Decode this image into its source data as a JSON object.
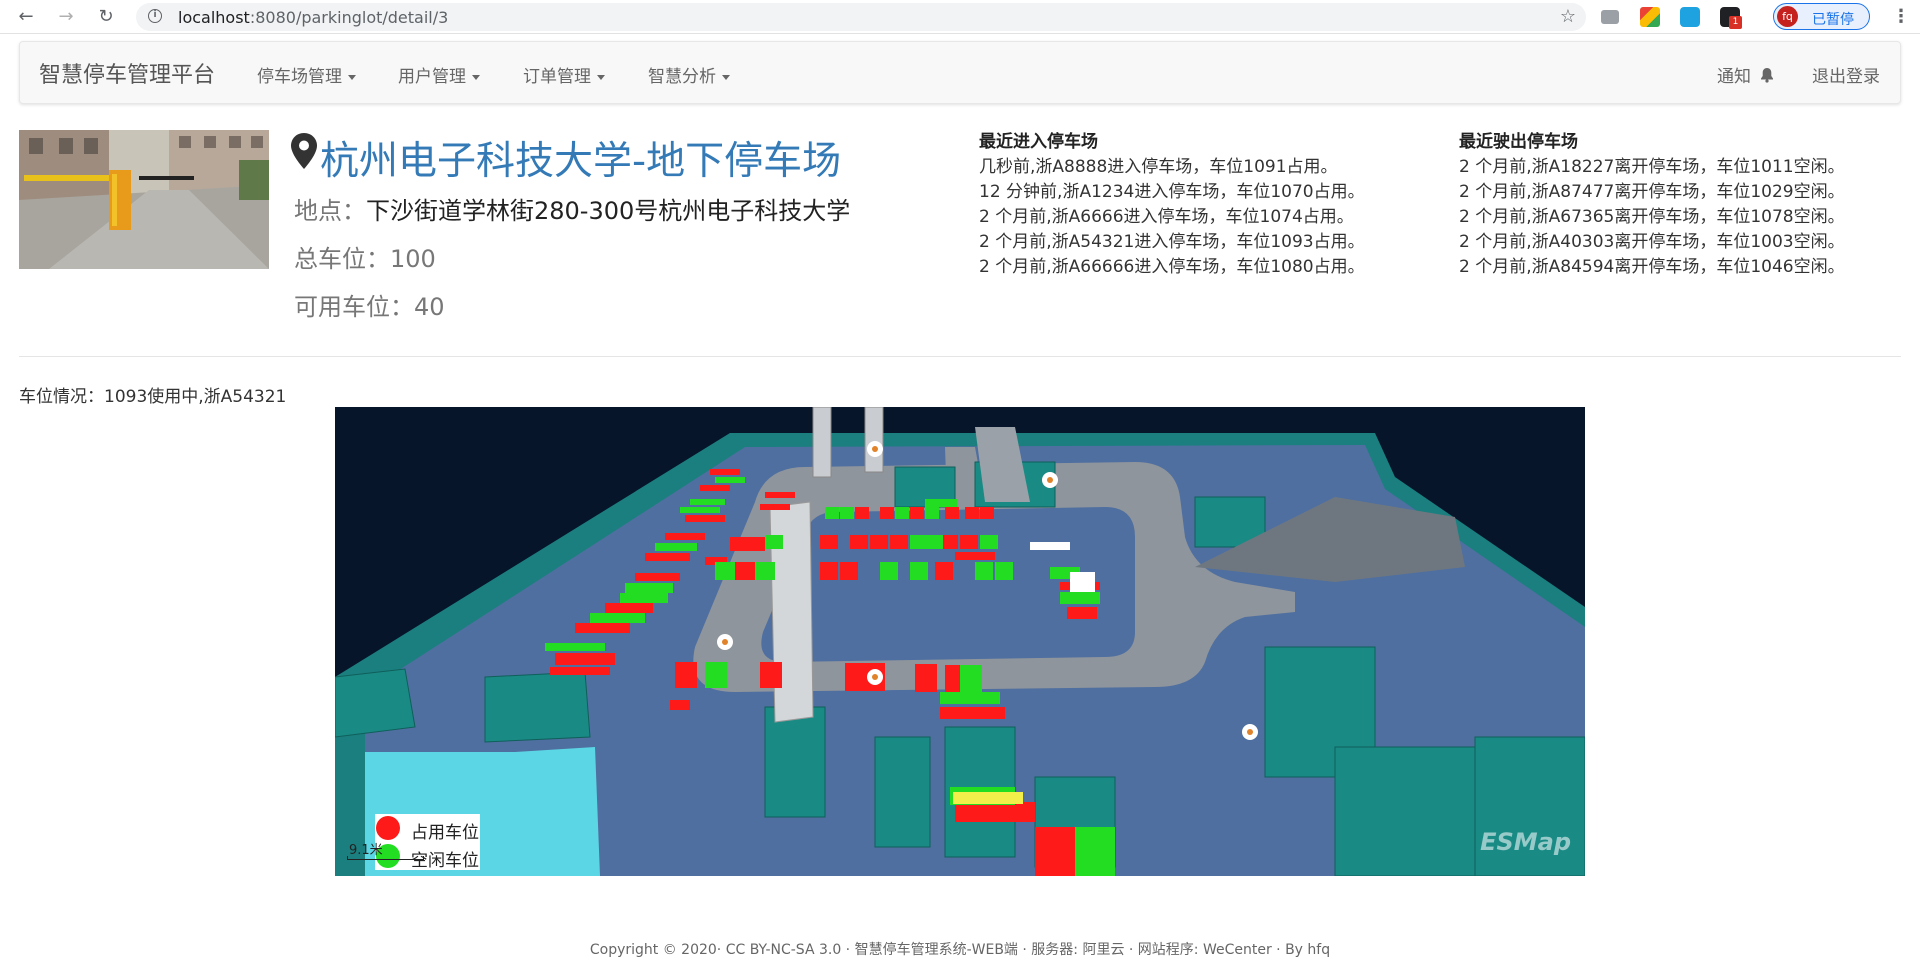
{
  "browser": {
    "url_host": "localhost",
    "url_path": ":8080/parkinglot/detail/3",
    "profile_initials": "fq",
    "profile_status": "已暂停",
    "ext_badge": "1"
  },
  "navbar": {
    "brand": "智慧停车管理平台",
    "menus": [
      "停车场管理",
      "用户管理",
      "订单管理",
      "智慧分析"
    ],
    "notify": "通知",
    "logout": "退出登录"
  },
  "lot": {
    "name": "杭州电子科技大学-地下停车场",
    "address_label": "地点：",
    "address": "下沙街道学林街280-300号杭州电子科技大学",
    "total_label": "总车位：",
    "total": "100",
    "available_label": "可用车位：",
    "available": "40"
  },
  "recent_in": {
    "title": "最近进入停车场",
    "entries": [
      "几秒前,浙A8888进入停车场，车位1091占用。",
      "12 分钟前,浙A1234进入停车场，车位1070占用。",
      "2 个月前,浙A6666进入停车场，车位1074占用。",
      "2 个月前,浙A54321进入停车场，车位1093占用。",
      "2 个月前,浙A66666进入停车场，车位1080占用。"
    ]
  },
  "recent_out": {
    "title": "最近驶出停车场",
    "entries": [
      "2 个月前,浙A18227离开停车场，车位1011空闲。",
      "2 个月前,浙A87477离开停车场，车位1029空闲。",
      "2 个月前,浙A67365离开停车场，车位1078空闲。",
      "2 个月前,浙A40303离开停车场，车位1003空闲。",
      "2 个月前,浙A84594离开停车场，车位1046空闲。"
    ]
  },
  "status_line": "车位情况：1093使用中,浙A54321",
  "map": {
    "legend_occupied": "占用车位",
    "legend_free": "空闲车位",
    "occupied_color": "#ff1a1a",
    "free_color": "#22dd22",
    "scale": "9.1米",
    "watermark": "ESMap"
  },
  "footer": "Copyright © 2020· CC BY-NC-SA 3.0 · 智慧停车管理系统-WEB端 · 服务器: 阿里云 · 网站程序: WeCenter · By hfq"
}
